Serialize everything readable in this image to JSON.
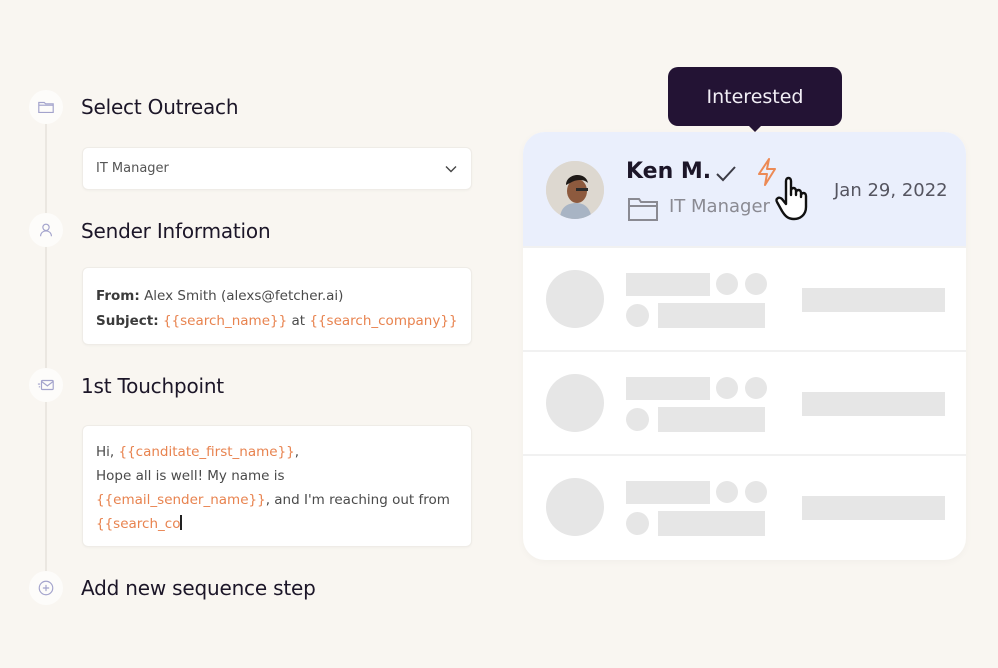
{
  "steps": {
    "select_outreach": {
      "title": "Select Outreach",
      "icon": "folder-icon",
      "dropdown_value": "IT Manager"
    },
    "sender_information": {
      "title": "Sender Information",
      "icon": "user-icon",
      "from_label": "From:",
      "from_value": "Alex Smith (alexs@fetcher.ai)",
      "subject_label": "Subject:",
      "subject_var1": "{{search_name}}",
      "subject_mid": "at",
      "subject_var2": "{{search_company}}"
    },
    "first_touchpoint": {
      "title": "1st Touchpoint",
      "icon": "mail-send-icon",
      "line1_prefix": "Hi, ",
      "line1_var": "{{canditate_first_name}}",
      "line1_suffix": ",",
      "line2": "Hope all is well! My name is",
      "line3_var": "{{email_sender_name}}",
      "line3_suffix": ", and I'm reaching out from",
      "line4_var": "{{search_co"
    },
    "add_step": {
      "title": "Add new sequence step",
      "icon": "plus-circle-icon"
    }
  },
  "candidate_panel": {
    "tooltip": "Interested",
    "active_candidate": {
      "name": "Ken M.",
      "role": "IT Manager",
      "date": "Jan 29, 2022",
      "status_icons": [
        "check-icon",
        "lightning-icon"
      ]
    },
    "placeholder_rows": 3
  },
  "colors": {
    "background": "#f9f6f1",
    "accent_variable": "#e8834f",
    "tooltip_bg": "#231334",
    "active_row_bg": "#eaeffc",
    "icon_muted": "#9a9bc7"
  }
}
